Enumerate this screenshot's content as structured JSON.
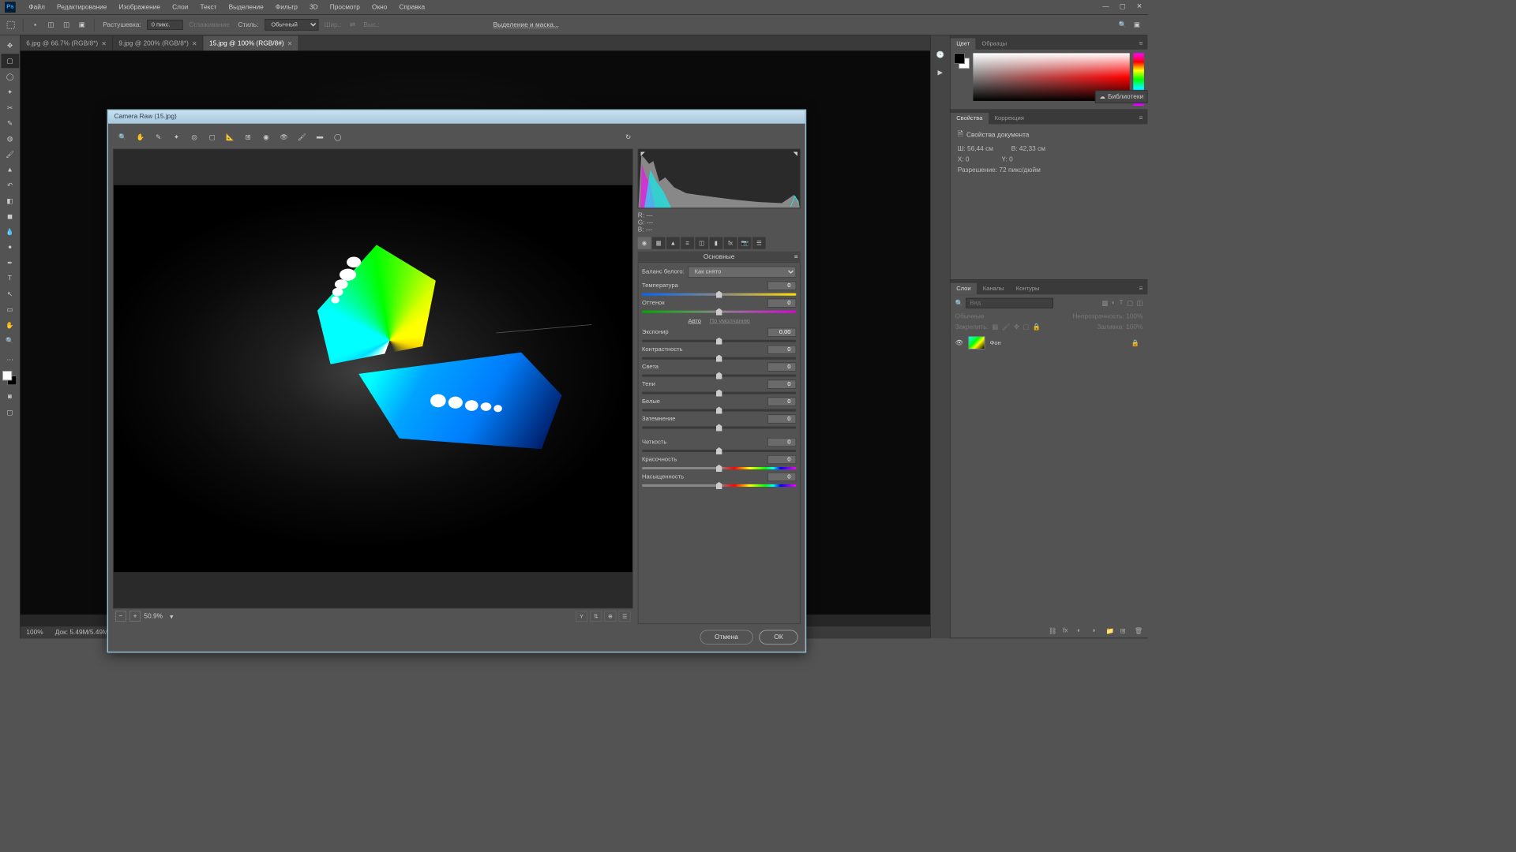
{
  "menubar": [
    "Файл",
    "Редактирование",
    "Изображение",
    "Слои",
    "Текст",
    "Выделение",
    "Фильтр",
    "3D",
    "Просмотр",
    "Окно",
    "Справка"
  ],
  "options": {
    "feather_label": "Растушевка:",
    "feather_value": "0 пикс.",
    "antialias": "Сглаживание",
    "style_label": "Стиль:",
    "style_value": "Обычный",
    "width_label": "Шир.:",
    "height_label": "Выс.:",
    "refine": "Выделение и маска..."
  },
  "tabs": [
    {
      "label": "6.jpg @ 66.7% (RGB/8*)",
      "active": false
    },
    {
      "label": "9.jpg @ 200% (RGB/8*)",
      "active": false
    },
    {
      "label": "15.jpg @ 100% (RGB/8#)",
      "active": true
    }
  ],
  "status": {
    "zoom": "100%",
    "doc": "Док: 5.49M/5.49M"
  },
  "panels": {
    "color_tabs": [
      "Цвет",
      "Образцы"
    ],
    "libraries": "Библиотеки",
    "props_tabs": [
      "Свойства",
      "Коррекция"
    ],
    "props": {
      "title": "Свойства документа",
      "w_label": "Ш:",
      "w": "56,44 см",
      "h_label": "В:",
      "h": "42,33 см",
      "x_label": "X:",
      "x": "0",
      "y_label": "Y:",
      "y": "0",
      "res": "Разрешение: 72 пикс/дюйм"
    },
    "layers_tabs": [
      "Слои",
      "Каналы",
      "Контуры"
    ],
    "layers": {
      "search_ph": "Вид",
      "blend": "Обычные",
      "opacity_label": "Непрозрачность:",
      "opacity": "100%",
      "lock_label": "Закрепить:",
      "fill_label": "Заливка:",
      "fill": "100%",
      "layer_name": "Фон"
    }
  },
  "camera_raw": {
    "title": "Camera Raw (15.jpg)",
    "zoom": "50.9%",
    "rgb": {
      "r": "R:",
      "g": "G:",
      "b": "B:",
      "dash": "---"
    },
    "panel_title": "Основные",
    "wb_label": "Баланс белого:",
    "wb_value": "Как снято",
    "auto": "Авто",
    "default": "По умолчанию",
    "sliders": [
      {
        "key": "temp",
        "label": "Температура",
        "value": "0",
        "track": "temp"
      },
      {
        "key": "tint",
        "label": "Оттенок",
        "value": "0",
        "track": "tint"
      }
    ],
    "sliders2": [
      {
        "key": "exposure",
        "label": "Экспонир",
        "value": "0,00"
      },
      {
        "key": "contrast",
        "label": "Контрастность",
        "value": "0"
      },
      {
        "key": "highlights",
        "label": "Света",
        "value": "0"
      },
      {
        "key": "shadows",
        "label": "Тени",
        "value": "0"
      },
      {
        "key": "whites",
        "label": "Белые",
        "value": "0"
      },
      {
        "key": "blacks",
        "label": "Затемнение",
        "value": "0"
      }
    ],
    "sliders3": [
      {
        "key": "clarity",
        "label": "Четкость",
        "value": "0"
      },
      {
        "key": "vibrance",
        "label": "Красочность",
        "value": "0",
        "track": "sat"
      },
      {
        "key": "saturation",
        "label": "Насыщенность",
        "value": "0",
        "track": "sat"
      }
    ],
    "cancel": "Отмена",
    "ok": "ОК"
  }
}
